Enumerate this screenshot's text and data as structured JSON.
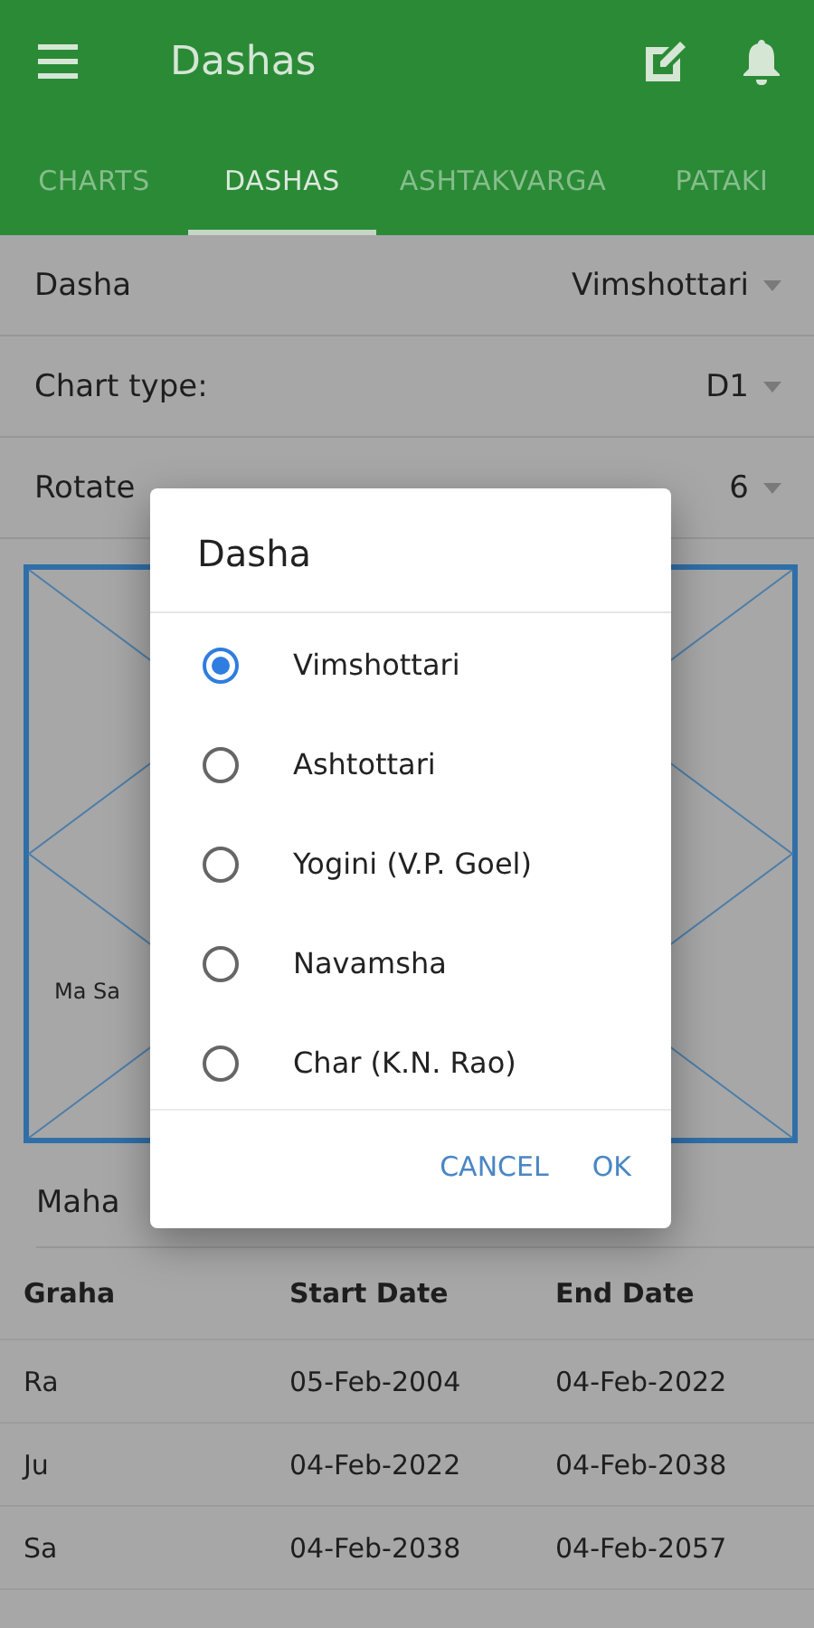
{
  "app_bar": {
    "title": "Dashas"
  },
  "tabs": [
    {
      "label": "CHARTS",
      "selected": false
    },
    {
      "label": "DASHAS",
      "selected": true
    },
    {
      "label": "ASHTAKVARGA",
      "selected": false
    },
    {
      "label": "PATAKI",
      "selected": false
    }
  ],
  "settings": [
    {
      "label": "Dasha",
      "value": "Vimshottari"
    },
    {
      "label": "Chart type:",
      "value": "D1"
    },
    {
      "label": "Rotate",
      "value": "6"
    }
  ],
  "chart": {
    "label": "Ma Sa"
  },
  "section_title": "Maha",
  "table": {
    "columns": [
      "Graha",
      "Start Date",
      "End Date"
    ],
    "rows": [
      [
        "Ra",
        "05-Feb-2004",
        "04-Feb-2022"
      ],
      [
        "Ju",
        "04-Feb-2022",
        "04-Feb-2038"
      ],
      [
        "Sa",
        "04-Feb-2038",
        "04-Feb-2057"
      ]
    ]
  },
  "dialog": {
    "title": "Dasha",
    "options": [
      {
        "label": "Vimshottari",
        "selected": true
      },
      {
        "label": "Ashtottari",
        "selected": false
      },
      {
        "label": "Yogini (V.P. Goel)",
        "selected": false
      },
      {
        "label": "Navamsha",
        "selected": false
      },
      {
        "label": "Char (K.N. Rao)",
        "selected": false
      }
    ],
    "buttons": [
      "CANCEL",
      "OK"
    ]
  }
}
